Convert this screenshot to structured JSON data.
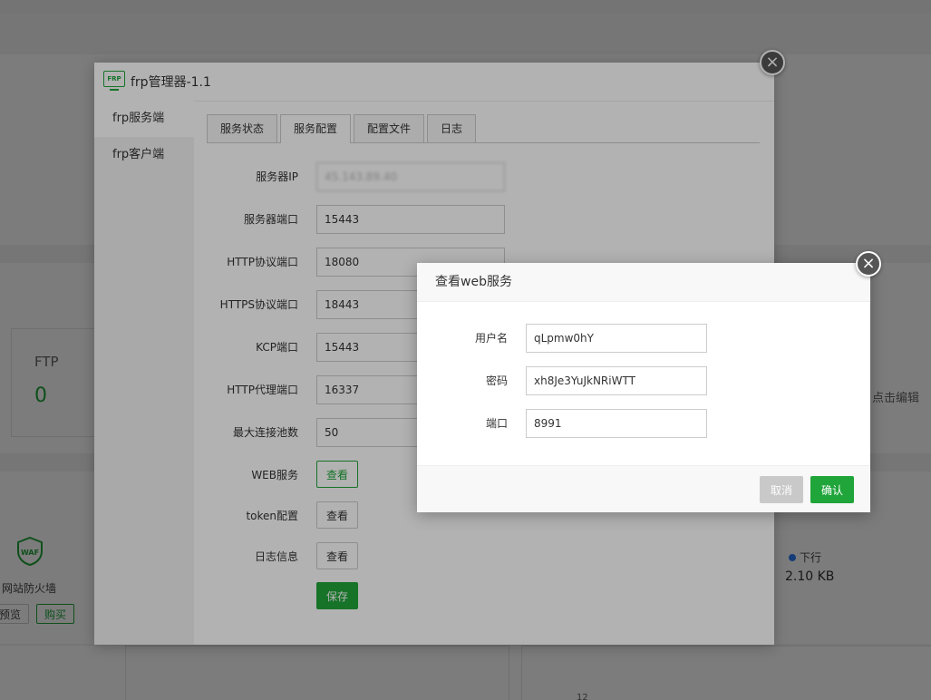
{
  "background": {
    "ftp_label": "FTP",
    "ftp_count": "0",
    "waf_icon_text": "WAF",
    "waf_label": "网站防火墙",
    "preview_btn": "预览",
    "buy_btn": "购买",
    "download_legend": "下行",
    "download_value": "2.10 KB",
    "edit_hint": "点击编辑",
    "small_number": "12"
  },
  "frp_window": {
    "logo_text": "FRP",
    "title": "frp管理器-1.1",
    "sidebar": [
      {
        "label": "frp服务端"
      },
      {
        "label": "frp客户端"
      }
    ],
    "tabs": [
      {
        "label": "服务状态"
      },
      {
        "label": "服务配置"
      },
      {
        "label": "配置文件"
      },
      {
        "label": "日志"
      }
    ],
    "active_tab": "服务配置",
    "form": {
      "server_ip_label": "服务器IP",
      "server_ip_value": "45.143.89.40",
      "server_port_label": "服务器端口",
      "server_port_value": "15443",
      "http_port_label": "HTTP协议端口",
      "http_port_value": "18080",
      "https_port_label": "HTTPS协议端口",
      "https_port_value": "18443",
      "kcp_port_label": "KCP端口",
      "kcp_port_value": "15443",
      "http_proxy_port_label": "HTTP代理端口",
      "http_proxy_port_value": "16337",
      "max_pool_label": "最大连接池数",
      "max_pool_value": "50",
      "web_service_label": "WEB服务",
      "web_service_btn": "查看",
      "token_label": "token配置",
      "token_btn": "查看",
      "log_label": "日志信息",
      "log_btn": "查看",
      "save_btn": "保存"
    }
  },
  "web_modal": {
    "title": "查看web服务",
    "username_label": "用户名",
    "username_value": "qLpmw0hY",
    "password_label": "密码",
    "password_value": "xh8Je3YuJkNRiWTT",
    "port_label": "端口",
    "port_value": "8991",
    "cancel_btn": "取消",
    "confirm_btn": "确认"
  },
  "colors": {
    "accent": "#20a53a",
    "close_button": "#555555",
    "cancel_button": "#c9c9c9"
  }
}
